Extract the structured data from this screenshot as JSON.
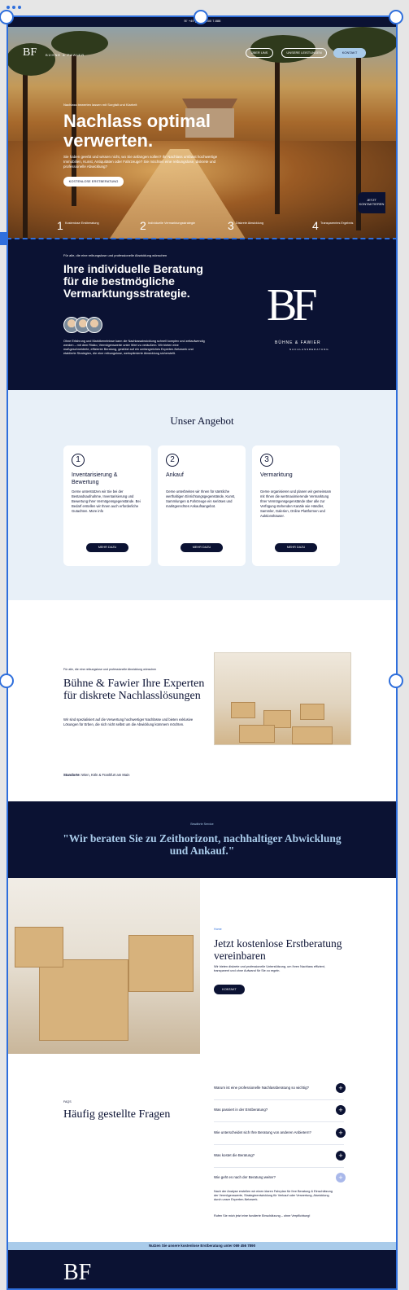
{
  "topbar": {
    "phone": "+49 (0) 000 000 7.888"
  },
  "nav": {
    "logo_initials": "BF",
    "brand": "BÜHNE & FAWIER",
    "links": [
      "ÜBER UNS",
      "UNSERE LEISTUNGEN"
    ],
    "contact": "KONTAKT"
  },
  "hero": {
    "eyebrow": "Nachlass bewerten lassen mit Sorgfalt und Klarheit",
    "title": "Nachlass optimal verwerten.",
    "subtitle": "Sie haben geerbt und wissen nicht, wo Sie anfangen sollen? Ihr Nachlass umfasst hochwertige Immobilien, Kunst, Antiquitäten oder Fahrzeuge? Sie möchten eine reibungslose, diskrete und professionelle Abwicklung?",
    "cta": "KOSTENLOSE ERSTBERATUNG",
    "badge": "JETZT KONTAKTIEREN",
    "steps": [
      {
        "num": "1",
        "label": "Kostenlose Erstberatung"
      },
      {
        "num": "2",
        "label": "Individuelle Vermarktungsstrategie"
      },
      {
        "num": "3",
        "label": "Diskrete Abwicklung"
      },
      {
        "num": "4",
        "label": "Transparentes Ergebnis"
      }
    ]
  },
  "about": {
    "eyebrow": "Für alle, die eine reibungslose und professionelle Abwicklung wünschen",
    "title": "Ihre individuelle Beratung für die bestmögliche Vermarktungsstrategie.",
    "text": "Ohne Erfahrung und Marktkenntnisse kann die Nachlassabwicklung schnell komplex und zeitaufwendig werden – mit dem Risiko, Vermögenswerte unter Wert zu veräußern. Wir bieten eine maßgeschneiderte, effiziente Beratung, gestützt auf ein umfangreiches Experten-Netzwerk und etablierte Strategien, die eine reibungslose, wertoptimierte Abwicklung sicherstellt.",
    "logo_letters": "BF",
    "logo_name": "BÜHNE & FAWIER",
    "logo_sub": "NACHLASSBERATUNG"
  },
  "angebot": {
    "title": "Unser Angebot",
    "cards": [
      {
        "num": "1",
        "title": "Inventarisierung & Bewertung",
        "text": "Gerne unterstützen wir Sie bei der Bestandsaufnahme, Inventarisierung und Bewertung Ihrer Vermögensgegenstände. Bei Bedarf erstellen wir Ihnen auch erforderliche Gutachten. More info",
        "button": "MEHR DAZU"
      },
      {
        "num": "2",
        "title": "Ankauf",
        "text": "Gerne unterbreiten wir Ihnen für sämtliche werthaltigen Einrichtungsgegenstände, Kunst, Sammlungen & Fahrzeuge ein seriöses und marktgerechtes Ankaufsangebot.",
        "button": "MEHR DAZU"
      },
      {
        "num": "3",
        "title": "Vermarktung",
        "text": "Gerne organisieren und planen wir gemeinsam mit Ihnen die wertmaximierende Vermarktung Ihrer Vermögensgegenstände über alle zur Verfügung stehenden Kanäle wie Händler, Sammler, Galerien, Online Plattformen und Auktionshäuser.",
        "button": "MEHR DAZU"
      }
    ]
  },
  "experts": {
    "eyebrow": "Für alle, die eine reibungslose und professionelle Abwicklung wünschen",
    "title": "Bühne & Fawier Ihre Experten für diskrete Nachlasslösungen",
    "text": "Wir sind spezialisiert auf die Verwertung hochwertiger Nachlässe und bieten exklusive Lösungen für Erben, die sich nicht selbst um die Abwicklung kümmern möchten.",
    "location_label": "Standorte:",
    "location_value": "Wien, Köln & Frankfurt am Main"
  },
  "quote": {
    "eyebrow": "Bewährte Service",
    "text": "\"Wir beraten Sie zu Zeithorizont, nachhaltiger Abwicklung und Ankauf.\""
  },
  "cta": {
    "eyebrow": "Home",
    "title": "Jetzt kostenlose Erstberatung vereinbaren",
    "text": "Wir bieten diskrete und professionelle Unterstützung, um Ihren Nachlass effizient, transparent und ohne Aufwand für Sie zu regeln.",
    "button": "KONTAKT"
  },
  "faq": {
    "eyebrow": "FAQS",
    "title": "Häufig gestellte Fragen",
    "items": [
      "Warum ist eine professionelle Nachlassberatung so wichtig?",
      "Was passiert in der Erstberatung?",
      "Wie unterscheidet sich Ihre Beratung von anderen Anbietern?",
      "Was kostet die Beratung?",
      "Wie geht es nach der Beratung weiter?"
    ],
    "answer": "Nach der Analyse erstellen wir einen klaren Fahrplan für Ihre Beratung & Einschätzung der Vermögenswerte, Strategieentwicklung für Verkauf oder Verwertung, Abwicklung durch unser Experten-Netzwerk.",
    "answer2": "Rufen Sie mich jetzt eine fundierte Einschätzung – ohne Verpflichtung!"
  },
  "footer": {
    "bar": "Nutzen Sie unsere kostenlose Erstberatung unter 069 456 7890",
    "logo": "BF"
  },
  "colors": {
    "navy": "#0b1233",
    "accent": "#a9cbea",
    "selection": "#2f6fdc"
  }
}
